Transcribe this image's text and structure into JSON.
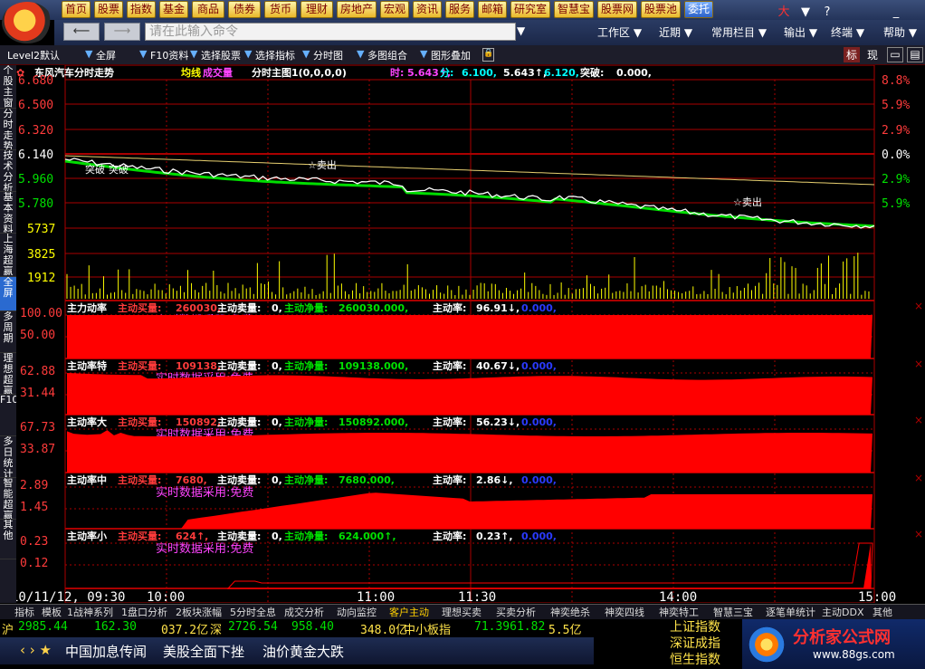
{
  "menu": [
    "首页",
    "股票",
    "指数",
    "基金",
    "商品",
    "债券",
    "货币",
    "理财",
    "房地产",
    "宏观",
    "资讯",
    "服务",
    "邮箱",
    "研究室",
    "智慧宝",
    "股票网",
    "股票池",
    "委托"
  ],
  "menu_active": "委托",
  "system_icons": [
    "大",
    "▼",
    "?",
    "_",
    "□",
    "×"
  ],
  "nav": {
    "command_placeholder": "请在此输入命令",
    "items": [
      "工作区 ▼",
      "近期 ▼",
      "常用栏目 ▼",
      "输出 ▼",
      "终端 ▼",
      "帮助 ▼"
    ]
  },
  "tools": [
    "Level2默认",
    "全屏",
    "F10资料",
    "选择股票",
    "选择指标",
    "分时图",
    "多图组合",
    "图形叠加"
  ],
  "right_tabs": [
    "标",
    "现"
  ],
  "left_tabs": [
    "个股主窗",
    "分时走势",
    "技术分析",
    "基本资料",
    "上海超赢",
    "全屏",
    "多周期",
    "理想超赢",
    "F10",
    "多日统计",
    "智能超赢",
    "其他"
  ],
  "left_tab_active": "全屏",
  "main_header": {
    "title": "东风汽车分时走势",
    "avg": "均线",
    "vol": "成交量",
    "subtitle": "分时主图1(0,0,0,0)",
    "time_label": "时:",
    "time_val": "5.643↑,",
    "min_label": "分:",
    "min_val": "6.100,",
    "val3": "5.643↑,",
    "val4": "6.120,",
    "break_label": "突破:",
    "break_val": "0.000,"
  },
  "price_axis": [
    "6.680",
    "6.500",
    "6.320",
    "6.140",
    "5.960",
    "5.780"
  ],
  "pct_axis": [
    "8.8%",
    "5.9%",
    "2.9%",
    "0.0%",
    "2.9%",
    "5.9%"
  ],
  "vol_axis": [
    "5737",
    "3825",
    "1912"
  ],
  "annotations": [
    "突破",
    "突破",
    "☆卖出",
    "☆卖出"
  ],
  "panels": [
    {
      "name": "主力动率",
      "buy_label": "主动买量:",
      "buy": "260030,",
      "sell_label": "主动卖量:",
      "sell": "0,",
      "net_label": "主动净量:",
      "net": "260030.000,",
      "rate_label": "主动率:",
      "rate": "96.91↓,",
      "extra": "0.000,",
      "note": "实时数据采用:免费",
      "axis": [
        "100.00",
        "50.00"
      ]
    },
    {
      "name": "主动率特",
      "buy_label": "主动买量:",
      "buy": "109138,",
      "sell_label": "主动卖量:",
      "sell": "0,",
      "net_label": "主动净量:",
      "net": "109138.000,",
      "rate_label": "主动率:",
      "rate": "40.67↓,",
      "extra": "0.000,",
      "note": "实时数据采用:免费",
      "axis": [
        "62.88",
        "31.44"
      ]
    },
    {
      "name": "主动率大",
      "buy_label": "主动买量:",
      "buy": "150892,",
      "sell_label": "主动卖量:",
      "sell": "0,",
      "net_label": "主动净量:",
      "net": "150892.000,",
      "rate_label": "主动率:",
      "rate": "56.23↓,",
      "extra": "0.000,",
      "note": "实时数据采用:免费",
      "axis": [
        "67.73",
        "33.87"
      ]
    },
    {
      "name": "主动率中",
      "buy_label": "主动买量:",
      "buy": "7680,",
      "sell_label": "主动卖量:",
      "sell": "0,",
      "net_label": "主动净量:",
      "net": "7680.000,",
      "rate_label": "主动率:",
      "rate": "2.86↓,",
      "extra": "0.000,",
      "note": "实时数据采用:免费",
      "axis": [
        "2.89",
        "1.45"
      ]
    },
    {
      "name": "主动率小",
      "buy_label": "主动买量:",
      "buy": "624↑,",
      "sell_label": "主动卖量:",
      "sell": "0,",
      "net_label": "主动净量:",
      "net": "624.000↑,",
      "rate_label": "主动率:",
      "rate": "0.23↑,",
      "extra": "0.000,",
      "note": "实时数据采用:免费",
      "axis": [
        "0.23",
        "0.12"
      ]
    }
  ],
  "time_axis": [
    "10/11/12, 09:30",
    "10:00",
    "11:00",
    "11:30",
    "14:00",
    "15:00"
  ],
  "bottom_tabs": [
    "指标",
    "模板",
    "1战神系列",
    "1盘口分析",
    "2板块涨幅",
    "5分时全息",
    "成交分析",
    "动向监控",
    "客户主动",
    "理想买卖",
    "买卖分析",
    "神奕绝杀",
    "神奕四线",
    "神奕特工",
    "智慧三宝",
    "逐笔单统计",
    "主动DDX",
    "其他"
  ],
  "bottom_tab_active": "客户主动",
  "index_row": [
    {
      "label": "沪",
      "value": "2985.44",
      "change": "162.30",
      "amount": "037.2亿"
    },
    {
      "label": "深",
      "value": "2726.54",
      "change": "958.40",
      "amount": "348.0亿"
    },
    {
      "label": "中小板指",
      "value": "71.3961.82",
      "change": "",
      "amount": "5.5亿"
    }
  ],
  "news": {
    "arrows": "‹ › ★",
    "items": [
      "中国加息传闻",
      "美股全面下挫",
      "油价黄金大跌"
    ]
  },
  "right_indices": [
    "上证指数",
    "深证成指",
    "恒生指数"
  ],
  "brand": {
    "name": "分析家公式网",
    "url": "www.88gs.com"
  },
  "colors": {
    "up": "#ff3b3b",
    "down": "#00e000",
    "axis": "#aa0000",
    "fill": "#ff0000",
    "gold": "#ffff00",
    "cyan": "#00ffff",
    "magenta": "#ff44ff"
  }
}
